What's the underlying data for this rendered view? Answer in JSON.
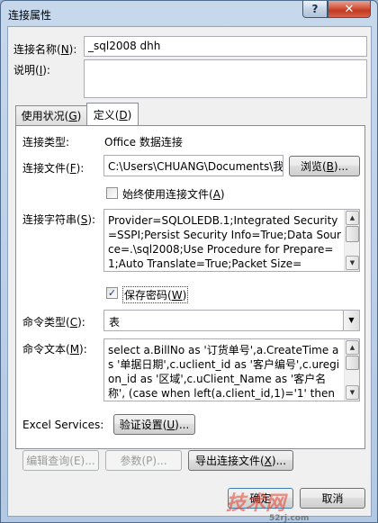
{
  "window": {
    "title": "连接属性",
    "help_glyph": "?",
    "close_glyph": "✕"
  },
  "header": {
    "name_label": "连接名称(",
    "name_key": "N",
    "name_label_end": "):",
    "name_value": "_sql2008 dhh",
    "desc_label": "说明(",
    "desc_key": "I",
    "desc_label_end": "):",
    "desc_value": ""
  },
  "tabs": [
    {
      "label": "使用状况(",
      "key": "G",
      "end": ")"
    },
    {
      "label": "定义(",
      "key": "D",
      "end": ")"
    }
  ],
  "definition": {
    "conn_type_label": "连接类型:",
    "conn_type_value": "Office 数据连接",
    "conn_file_label": "连接文件(",
    "conn_file_key": "F",
    "conn_file_end": "):",
    "conn_file_value": "C:\\Users\\CHUANG\\Documents\\我",
    "browse_label": "浏览(",
    "browse_key": "B",
    "browse_end": ")...",
    "always_use_label": "始终使用连接文件(",
    "always_use_key": "A",
    "always_use_end": ")",
    "always_use_checked": false,
    "conn_string_label": "连接字符串(",
    "conn_string_key": "S",
    "conn_string_end": "):",
    "conn_string_value": "Provider=SQLOLEDB.1;Integrated Security=SSPI;Persist Security Info=True;Data Source=.\\sql2008;Use Procedure for Prepare=1;Auto Translate=True;Packet Size=",
    "save_pwd_label": "保存密码(",
    "save_pwd_key": "W",
    "save_pwd_end": ")",
    "save_pwd_checked": true,
    "save_pwd_check_glyph": "✓",
    "cmd_type_label": "命令类型(",
    "cmd_type_key": "C",
    "cmd_type_end": "):",
    "cmd_type_value": "表",
    "cmd_text_label": "命令文本(",
    "cmd_text_key": "M",
    "cmd_text_end": "):",
    "cmd_text_value": "select a.BillNo as '订货单号',a.CreateTime as '单据日期',c.uclient_id as '客户编号',c.uregion_id as '区域',c.uClient_Name as '客户名称', (case when left(a.client_id,1)='1' then '聚鑫",
    "excel_services_label": "Excel Services:",
    "auth_settings_label": "验证设置(",
    "auth_settings_key": "U",
    "auth_settings_end": ")..."
  },
  "actions": {
    "edit_query": "编辑查询(E)...",
    "params": "参数(P)...",
    "export_label": "导出连接文件(",
    "export_key": "X",
    "export_end": ")...",
    "ok": "确定",
    "cancel": "取消"
  },
  "watermark": {
    "text": "技术网",
    "sub": "52rj.com"
  }
}
